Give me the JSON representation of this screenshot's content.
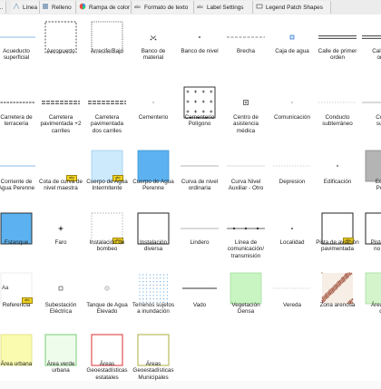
{
  "tabs": [
    {
      "label": "..."
    },
    {
      "label": "Línea"
    },
    {
      "label": "Relleno"
    },
    {
      "label": "Rampa de color"
    },
    {
      "label": "Formato de texto"
    },
    {
      "label": "Label Settings"
    },
    {
      "label": "Legend Patch Shapes"
    }
  ],
  "tab_icons": [
    "palette-icon",
    "line-icon",
    "fill-icon",
    "color-ramp-icon",
    "text-format-icon",
    "label-settings-icon",
    "legend-patch-icon"
  ],
  "symbols": [
    {
      "label": "Acueducto\nsuperficial",
      "preview": "line-blue"
    },
    {
      "label": "Aeropuerto",
      "preview": "rect-dashed"
    },
    {
      "label": "Arrecife/Bajo",
      "preview": "rect-dashed-small"
    },
    {
      "label": "Banco de\nmaterial",
      "preview": "bank-marker"
    },
    {
      "label": "Banco de nivel",
      "preview": "dot"
    },
    {
      "label": "Brecha",
      "preview": "line-dashed"
    },
    {
      "label": "Caja de agua",
      "preview": "square-blue"
    },
    {
      "label": "Calle de primer\norden",
      "preview": "line-double"
    },
    {
      "label": "Calle d\nord",
      "preview": "line-double"
    },
    {
      "label": "Carretera de\nterraceria",
      "preview": "line-terraceria"
    },
    {
      "label": "Carretera\npavimentada +2\ncarriles",
      "preview": "line-double-dark"
    },
    {
      "label": "Carretera\npavimentada\ndos carriles",
      "preview": "line-double-dark"
    },
    {
      "label": "Cementerio",
      "preview": "dot-small"
    },
    {
      "label": "Cementerio\nPolígono",
      "preview": "rect-crosses"
    },
    {
      "label": "Centro de\nasistencia\nmédica",
      "preview": "medical"
    },
    {
      "label": "Comunicación",
      "preview": "dot-small"
    },
    {
      "label": "Conducto\nsubterráneo",
      "preview": "line-light-dashed"
    },
    {
      "label": "Con\nsub",
      "preview": "line-gray"
    },
    {
      "label": "Corriente de\nAgua Perenne",
      "preview": "line-blue"
    },
    {
      "label": "Cota de curva de\nnivel maestra",
      "preview": "badge-only"
    },
    {
      "label": "Cuerpo de Agua\nIntermitente",
      "preview": "rect-lightblue-badge"
    },
    {
      "label": "Cuerpo de Agua\nPerenne",
      "preview": "rect-blue"
    },
    {
      "label": "Curva de nivel\nordinaria",
      "preview": "line-gray"
    },
    {
      "label": "Curva Nivel\nAuxiliar - Otro",
      "preview": "line-gray-thin"
    },
    {
      "label": "Depresion",
      "preview": "line-light-dashed"
    },
    {
      "label": "Edificación",
      "preview": "dot-gray"
    },
    {
      "label": "Edifi\nPolí",
      "preview": "rect-gray"
    },
    {
      "label": "Estanque",
      "preview": "rect-blue-solid"
    },
    {
      "label": "Faro",
      "preview": "faro"
    },
    {
      "label": "Instalación de\nbombeo",
      "preview": "rect-dashed-badge"
    },
    {
      "label": "Instalación\ndiversa",
      "preview": "rect-outline"
    },
    {
      "label": "Lindero",
      "preview": "line-gray"
    },
    {
      "label": "Línea de\ncomunicación/\ntransmisión",
      "preview": "line-dots"
    },
    {
      "label": "Localidad",
      "preview": "dot"
    },
    {
      "label": "Pista de aviación\npavimentada",
      "preview": "rect-outline-badge"
    },
    {
      "label": "Pista de\nno pa",
      "preview": "rect-outline"
    },
    {
      "label": "Referencia",
      "preview": "referencia"
    },
    {
      "label": "Subestación\nEléctrica",
      "preview": "square-small"
    },
    {
      "label": "Tanque de Agua\nElevado",
      "preview": "circle-small"
    },
    {
      "label": "Terrenos sujetos\na inundación",
      "preview": "rect-dotted-blue"
    },
    {
      "label": "Vado",
      "preview": "line-dark-short"
    },
    {
      "label": "Vegetación\nDensa",
      "preview": "rect-green"
    },
    {
      "label": "Vereda",
      "preview": "line-light-dashed"
    },
    {
      "label": "Zona arenosa",
      "preview": "sandy"
    },
    {
      "label": "Área de\nd",
      "preview": "rect-green-light"
    },
    {
      "label": "Área urbana",
      "preview": "rect-yellow"
    },
    {
      "label": "Área verde\nurbana",
      "preview": "rect-green-outline"
    },
    {
      "label": "Áreas\nGeoestadísticas\nestatales",
      "preview": "rect-red-outline"
    },
    {
      "label": "Áreas\nGeoestadísticas\nMunicipales",
      "preview": "rect-olive-outline"
    }
  ],
  "badge_text": "abc",
  "referencia_text": "Aa",
  "colors": {
    "water": "#5cb2f0",
    "water_light": "#cdeafc",
    "line_gray": "#b4b4b4",
    "green_fill": "#c8f5c2",
    "yellow_fill": "#fbfbb0",
    "outline_red": "#e04040",
    "outline_olive": "#b4b450",
    "badge_yellow": "#f2d321"
  }
}
